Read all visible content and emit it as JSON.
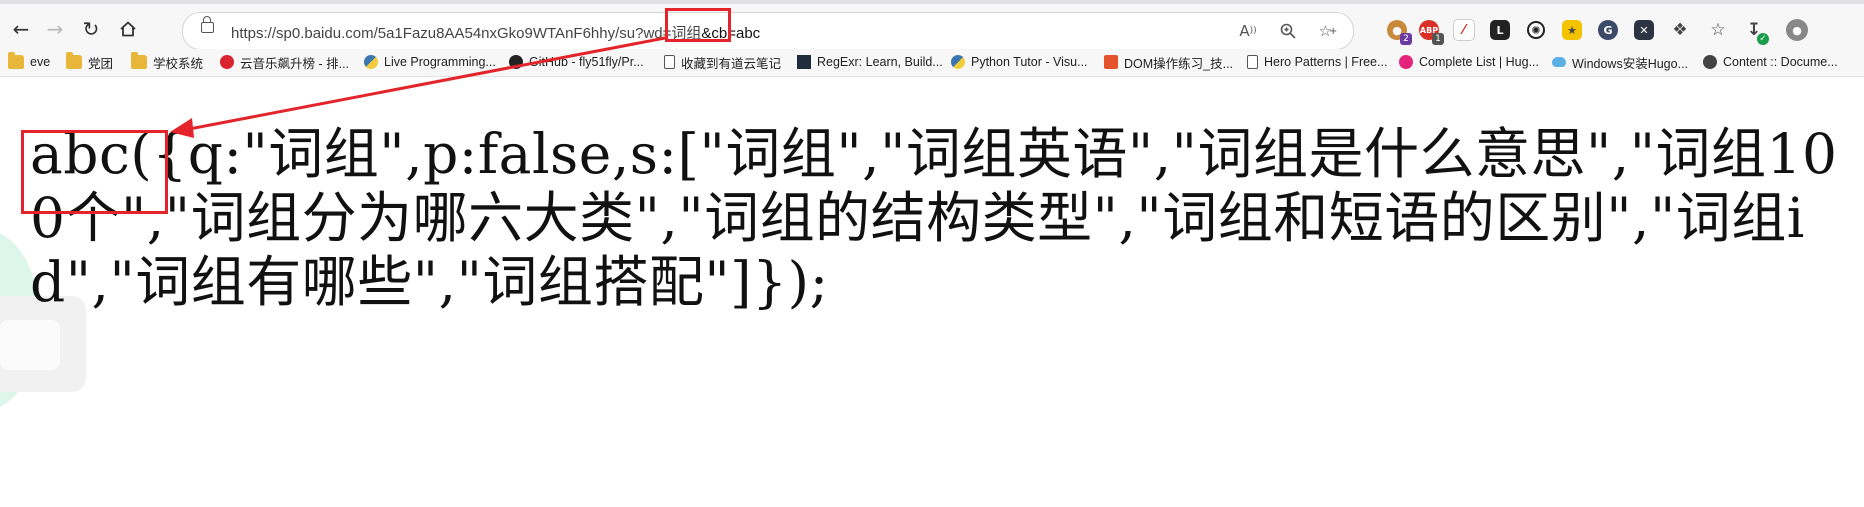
{
  "toolbar": {
    "url_main": "https://sp0.baidu.com/5a1Fazu8AA54nxGko9WTAnF6hhy/su?wd=词组",
    "url_highlight": "&cb=abc"
  },
  "bookmarks": [
    {
      "label": "eve",
      "icon": "folder-icon"
    },
    {
      "label": "党团",
      "icon": "folder-icon"
    },
    {
      "label": "学校系统",
      "icon": "folder-icon"
    },
    {
      "label": "云音乐飙升榜 - 排...",
      "icon": "netease-music-icon"
    },
    {
      "label": "Live Programming...",
      "icon": "python-icon"
    },
    {
      "label": "GitHub - fly51fly/Pr...",
      "icon": "github-icon"
    },
    {
      "label": "收藏到有道云笔记",
      "icon": "document-icon"
    },
    {
      "label": "RegExr: Learn, Build...",
      "icon": "regexr-icon"
    },
    {
      "label": "Python Tutor - Visu...",
      "icon": "python-icon"
    },
    {
      "label": "DOM操作练习_技...",
      "icon": "csdn-icon"
    },
    {
      "label": "Hero Patterns | Free...",
      "icon": "document-icon"
    },
    {
      "label": "Complete List | Hug...",
      "icon": "hugo-icon"
    },
    {
      "label": "Windows安装Hugo...",
      "icon": "cloud-icon"
    },
    {
      "label": "Content :: Docume...",
      "icon": "docs-icon"
    }
  ],
  "content": {
    "callback_name": "abc(",
    "response_body": "{q:\"词组\",p:false,s:[\"词组\",\"词组英语\",\"词组是什么意思\",\"词组100个\",\"词组分为哪六大类\",\"词组的结构类型\",\"词组和短语的区别\",\"词组id\",\"词组有哪些\",\"词组搭配\"]});"
  },
  "colors": {
    "annotation": "#e3242b",
    "toolbar_bg": "#f7f7f7"
  }
}
